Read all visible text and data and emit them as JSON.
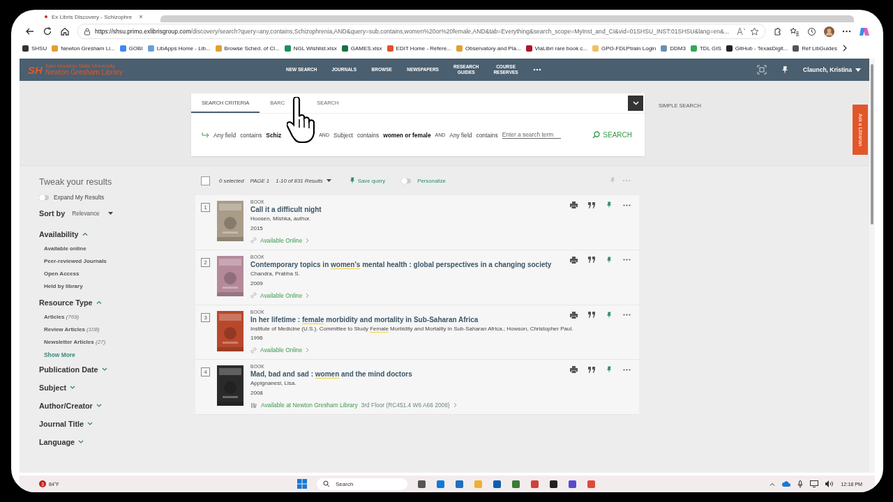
{
  "browser": {
    "tab_title": "Ex Libris Discovery - Schizophre",
    "tab_close": "×",
    "url_host": "https://shsu.primo.exlibrisgroup.com",
    "url_path": "/discovery/search?query=any,contains,Schizophrenia,AND&query=sub,contains,women%20or%20female,AND&tab=Everything&search_scope=MyInst_and_CI&vid=01SHSU_INST:01SHSU&lang=en&...",
    "bookmarks": [
      {
        "label": "SHSU"
      },
      {
        "label": "Newton Gresham Li..."
      },
      {
        "label": "GOBI"
      },
      {
        "label": "LibApps Home - Lib..."
      },
      {
        "label": "Browse Sched. of Cl..."
      },
      {
        "label": "NGL Wishlist.xlsx"
      },
      {
        "label": "GAMES.xlsx"
      },
      {
        "label": "EDIT Home - Refere..."
      },
      {
        "label": "Observatory and Pla..."
      },
      {
        "label": "ViaLibri rare book c..."
      },
      {
        "label": "GPO-FDLPtrain Login"
      },
      {
        "label": "DDM3"
      },
      {
        "label": "TDL GIS"
      },
      {
        "label": "GitHub - TexasDigit..."
      },
      {
        "label": "Ref LibGuides"
      }
    ]
  },
  "header": {
    "logo_mark": "SH",
    "logo_small": "Sam Houston State University",
    "logo_name": "Newton Gresham Library",
    "nav": [
      {
        "label": "NEW SEARCH"
      },
      {
        "label": "JOURNALS"
      },
      {
        "label": "BROWSE"
      },
      {
        "label": "NEWSPAPERS"
      },
      {
        "label": "RESEARCH GUIDES"
      },
      {
        "label": "COURSE RESERVES"
      }
    ],
    "user": "Claunch, Kristina"
  },
  "search": {
    "tabs": [
      {
        "parts": [
          "SEARCH CRITERIA"
        ],
        "selected": true
      },
      {
        "parts": [
          "BARC",
          "SEARCH"
        ],
        "selected": false
      }
    ],
    "simple_search": "SIMPLE SEARCH",
    "query": [
      {
        "kind": "term",
        "field": "Any field",
        "op": "contains",
        "value": "Schiz"
      },
      {
        "kind": "term",
        "joiner": "AND",
        "field": "Subject",
        "op": "contains",
        "value": "women or female"
      },
      {
        "kind": "input",
        "joiner": "AND",
        "field": "Any field",
        "op": "contains",
        "placeholder": "Enter a search term"
      }
    ],
    "button": "SEARCH"
  },
  "ask_librarian": "Ask a Librarian",
  "sidebar": {
    "title": "Tweak your results",
    "expand": {
      "label": "Expand My Results",
      "on": false
    },
    "sort_label": "Sort by",
    "sort_value": "Relevance",
    "facets": [
      {
        "label": "Availability",
        "expanded": true,
        "items": [
          {
            "label": "Available online"
          },
          {
            "label": "Peer-reviewed Journals"
          },
          {
            "label": "Open Access"
          },
          {
            "label": "Held by library"
          }
        ]
      },
      {
        "label": "Resource Type",
        "expanded": true,
        "items": [
          {
            "label": "Articles",
            "count": "(769)"
          },
          {
            "label": "Review Articles",
            "count": "(108)"
          },
          {
            "label": "Newsletter Articles",
            "count": "(27)"
          }
        ],
        "more": "Show More"
      },
      {
        "label": "Publication Date",
        "expanded": false
      },
      {
        "label": "Subject",
        "expanded": false
      },
      {
        "label": "Author/Creator",
        "expanded": false
      },
      {
        "label": "Journal Title",
        "expanded": false
      },
      {
        "label": "Language",
        "expanded": false
      }
    ]
  },
  "results_bar": {
    "select_all": {
      "checked": false
    },
    "selected_count": "0 selected",
    "page": "PAGE 1",
    "range": "1-10 of 831 Results",
    "save_query": "Save query",
    "personalize": {
      "label": "Personalize",
      "on": false
    }
  },
  "results": [
    {
      "number": "1",
      "type": "BOOK",
      "title": [
        {
          "text": "Call it a difficult night",
          "highlight": false
        }
      ],
      "author": [
        {
          "text": "Hoosen, Mishka, author.",
          "highlight": false
        }
      ],
      "year": "2015",
      "availability": {
        "kind": "online",
        "parts": [
          "Available Online"
        ]
      }
    },
    {
      "number": "2",
      "type": "BOOK",
      "title": [
        {
          "text": "Contemporary topics in ",
          "highlight": false
        },
        {
          "text": "women's",
          "highlight": true
        },
        {
          "text": " mental health : global perspectives in a changing society",
          "highlight": false
        }
      ],
      "author": [
        {
          "text": "Chandra, Prabha S.",
          "highlight": false
        }
      ],
      "year": "2009",
      "availability": {
        "kind": "online",
        "parts": [
          "Available Online"
        ]
      }
    },
    {
      "number": "3",
      "type": "BOOK",
      "title": [
        {
          "text": "In her lifetime : ",
          "highlight": false
        },
        {
          "text": "female",
          "highlight": true
        },
        {
          "text": " morbidity and mortality in Sub-Saharan Africa",
          "highlight": false
        }
      ],
      "author": [
        {
          "text": "Institute of Medicine (U.S.). Committee to Study ",
          "highlight": false
        },
        {
          "text": "Female",
          "highlight": true
        },
        {
          "text": " Morbidity and Mortality in Sub-Saharan Africa.; Howson, Christopher Paul.",
          "highlight": false
        }
      ],
      "year": "1996",
      "availability": {
        "kind": "online",
        "parts": [
          "Available Online"
        ]
      }
    },
    {
      "number": "4",
      "type": "BOOK",
      "title": [
        {
          "text": "Mad, bad and sad : ",
          "highlight": false
        },
        {
          "text": "women",
          "highlight": true
        },
        {
          "text": " and the mind doctors",
          "highlight": false
        }
      ],
      "author": [
        {
          "text": "Appignanesi, Lisa.",
          "highlight": false
        }
      ],
      "year": "2008",
      "availability": {
        "kind": "physical",
        "parts": [
          "Available at Newton Gresham Library",
          "3rd Floor (RC451.4 W6 A66 2008)"
        ]
      }
    }
  ],
  "taskbar": {
    "weather_badge": "3",
    "weather": "84°F",
    "search_placeholder": "Search",
    "time": "12:18 PM"
  }
}
